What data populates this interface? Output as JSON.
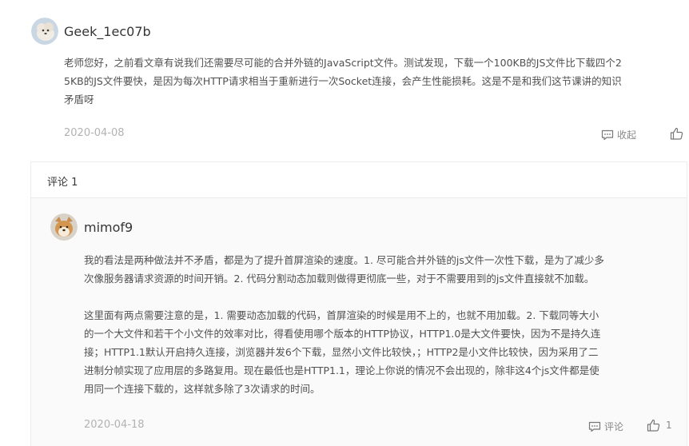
{
  "comment": {
    "username": "Geek_1ec07b",
    "lines": [
      "老师您好，之前看文章有说我们还需要尽可能的合并外链的JavaScript文件。测试发现，下载一个100KB的JS文件比下载四个2",
      "5KB的JS文件要快，是因为每次HTTP请求相当于重新进行一次Socket连接，会产生性能损耗。这是不是和我们这节课讲的知识",
      "矛盾呀"
    ],
    "date": "2020-04-08",
    "collapse_label": "收起"
  },
  "replies_section": {
    "header_label": "评论 1"
  },
  "reply": {
    "username": "mimof9",
    "para1": [
      "我的看法是两种做法并不矛盾，都是为了提升首屏渲染的速度。1. 尽可能合并外链的js文件一次性下载，是为了减少多",
      "次像服务器请求资源的时间开销。2. 代码分割动态加载则做得更彻底一些，对于不需要用到的js文件直接就不加载。"
    ],
    "para2": [
      "这里面有两点需要注意的是，1. 需要动态加载的代码，首屏渲染的时候是用不上的，也就不用加载。2. 下载同等大小",
      "的一个大文件和若干个小文件的效率对比，得看使用哪个版本的HTTP协议，HTTP1.0是大文件要快，因为不是持久连",
      "接；HTTP1.1默认开启持久连接，浏览器并发6个下载，显然小文件比较快，；HTTP2是小文件比较快，因为采用了二",
      "进制分帧实现了应用层的多路复用。现在最低也是HTTP1.1，理论上你说的情况不会出现的，除非这4个js文件都是使",
      "用同一个连接下载的，这样就多除了3次请求的时间。"
    ],
    "date": "2020-04-18",
    "comment_label": "评论",
    "like_count": "1"
  }
}
